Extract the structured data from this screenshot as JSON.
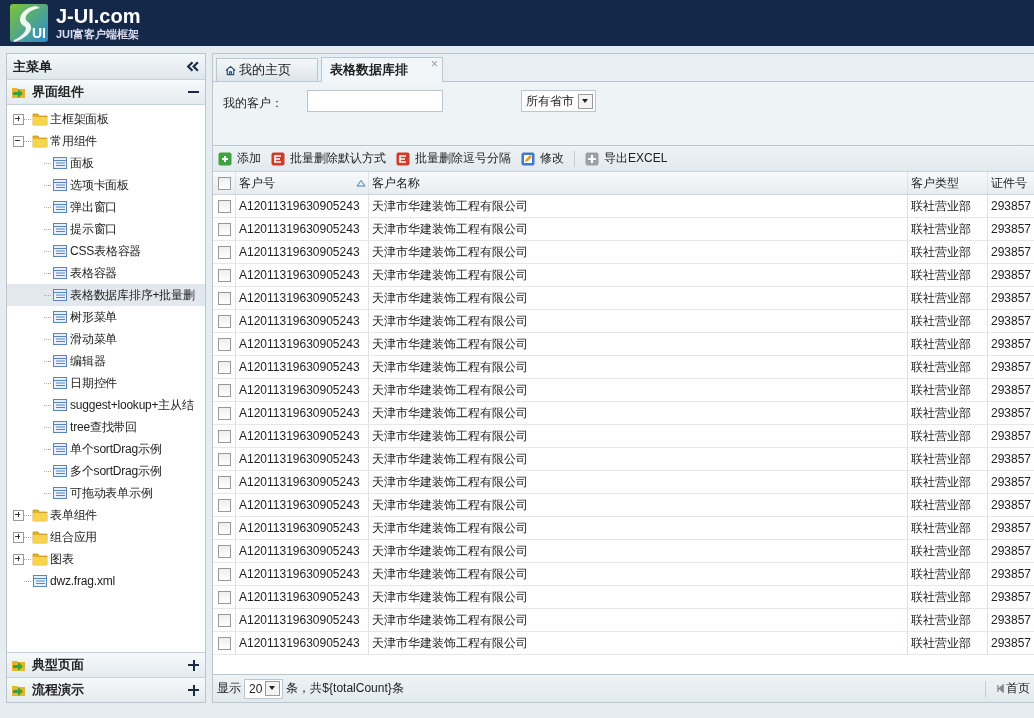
{
  "header": {
    "logo_mark": "UI",
    "site": "J-UI.com",
    "tagline": "JUI富客户端框架"
  },
  "sidebar": {
    "title": "主菜单",
    "sections": [
      {
        "label": "界面组件",
        "expanded": true,
        "tree": [
          {
            "label": "主框架面板",
            "kind": "folder",
            "expanded": false,
            "selected": false
          },
          {
            "label": "常用组件",
            "kind": "folder",
            "expanded": true,
            "selected": false,
            "children": [
              {
                "label": "面板",
                "kind": "page",
                "selected": false
              },
              {
                "label": "选项卡面板",
                "kind": "page",
                "selected": false
              },
              {
                "label": "弹出窗口",
                "kind": "page",
                "selected": false
              },
              {
                "label": "提示窗口",
                "kind": "page",
                "selected": false
              },
              {
                "label": "CSS表格容器",
                "kind": "page",
                "selected": false
              },
              {
                "label": "表格容器",
                "kind": "page",
                "selected": false
              },
              {
                "label": "表格数据库排序+批量删",
                "kind": "page",
                "selected": true
              },
              {
                "label": "树形菜单",
                "kind": "page",
                "selected": false
              },
              {
                "label": "滑动菜单",
                "kind": "page",
                "selected": false
              },
              {
                "label": "编辑器",
                "kind": "page",
                "selected": false
              },
              {
                "label": "日期控件",
                "kind": "page",
                "selected": false
              },
              {
                "label": "suggest+lookup+主从结",
                "kind": "page",
                "selected": false
              },
              {
                "label": "tree查找带回",
                "kind": "page",
                "selected": false
              },
              {
                "label": "单个sortDrag示例",
                "kind": "page",
                "selected": false
              },
              {
                "label": "多个sortDrag示例",
                "kind": "page",
                "selected": false
              },
              {
                "label": "可拖动表单示例",
                "kind": "page",
                "selected": false
              }
            ]
          },
          {
            "label": "表单组件",
            "kind": "folder",
            "expanded": false,
            "selected": false
          },
          {
            "label": "组合应用",
            "kind": "folder",
            "expanded": false,
            "selected": false
          },
          {
            "label": "图表",
            "kind": "folder",
            "expanded": false,
            "selected": false
          },
          {
            "label": "dwz.frag.xml",
            "kind": "page",
            "selected": false
          }
        ]
      },
      {
        "label": "典型页面",
        "expanded": false
      },
      {
        "label": "流程演示",
        "expanded": false
      }
    ]
  },
  "tabs": [
    {
      "label": "我的主页",
      "kind": "home",
      "selected": false
    },
    {
      "label": "表格数据库排",
      "kind": "closable",
      "selected": true,
      "close": "×"
    }
  ],
  "search": {
    "label": "我的客户：",
    "select": "所有省市"
  },
  "toolbar": [
    {
      "label": "添加",
      "kind": "add"
    },
    {
      "label": "批量删除默认方式",
      "kind": "delete"
    },
    {
      "label": "批量删除逗号分隔",
      "kind": "delete"
    },
    {
      "label": "修改",
      "kind": "edit"
    },
    {
      "label": "导出EXCEL",
      "kind": "export"
    }
  ],
  "table": {
    "columns": [
      {
        "label": "客户号",
        "sorted": true
      },
      {
        "label": "客户名称",
        "sorted": false
      },
      {
        "label": "客户类型",
        "sorted": false
      },
      {
        "label": "证件号",
        "sorted": false
      }
    ],
    "all_checked": false,
    "rows": [
      {
        "id": "A12011319630905243",
        "name": "天津市华建装饰工程有限公司",
        "type": "联社营业部",
        "cert": "293857",
        "checked": false
      },
      {
        "id": "A12011319630905243",
        "name": "天津市华建装饰工程有限公司",
        "type": "联社营业部",
        "cert": "293857",
        "checked": false
      },
      {
        "id": "A12011319630905243",
        "name": "天津市华建装饰工程有限公司",
        "type": "联社营业部",
        "cert": "293857",
        "checked": false
      },
      {
        "id": "A12011319630905243",
        "name": "天津市华建装饰工程有限公司",
        "type": "联社营业部",
        "cert": "293857",
        "checked": false
      },
      {
        "id": "A12011319630905243",
        "name": "天津市华建装饰工程有限公司",
        "type": "联社营业部",
        "cert": "293857",
        "checked": false
      },
      {
        "id": "A12011319630905243",
        "name": "天津市华建装饰工程有限公司",
        "type": "联社营业部",
        "cert": "293857",
        "checked": false
      },
      {
        "id": "A12011319630905243",
        "name": "天津市华建装饰工程有限公司",
        "type": "联社营业部",
        "cert": "293857",
        "checked": false
      },
      {
        "id": "A12011319630905243",
        "name": "天津市华建装饰工程有限公司",
        "type": "联社营业部",
        "cert": "293857",
        "checked": false
      },
      {
        "id": "A12011319630905243",
        "name": "天津市华建装饰工程有限公司",
        "type": "联社营业部",
        "cert": "293857",
        "checked": false
      },
      {
        "id": "A12011319630905243",
        "name": "天津市华建装饰工程有限公司",
        "type": "联社营业部",
        "cert": "293857",
        "checked": false
      },
      {
        "id": "A12011319630905243",
        "name": "天津市华建装饰工程有限公司",
        "type": "联社营业部",
        "cert": "293857",
        "checked": false
      },
      {
        "id": "A12011319630905243",
        "name": "天津市华建装饰工程有限公司",
        "type": "联社营业部",
        "cert": "293857",
        "checked": false
      },
      {
        "id": "A12011319630905243",
        "name": "天津市华建装饰工程有限公司",
        "type": "联社营业部",
        "cert": "293857",
        "checked": false
      },
      {
        "id": "A12011319630905243",
        "name": "天津市华建装饰工程有限公司",
        "type": "联社营业部",
        "cert": "293857",
        "checked": false
      },
      {
        "id": "A12011319630905243",
        "name": "天津市华建装饰工程有限公司",
        "type": "联社营业部",
        "cert": "293857",
        "checked": false
      },
      {
        "id": "A12011319630905243",
        "name": "天津市华建装饰工程有限公司",
        "type": "联社营业部",
        "cert": "293857",
        "checked": false
      },
      {
        "id": "A12011319630905243",
        "name": "天津市华建装饰工程有限公司",
        "type": "联社营业部",
        "cert": "293857",
        "checked": false
      },
      {
        "id": "A12011319630905243",
        "name": "天津市华建装饰工程有限公司",
        "type": "联社营业部",
        "cert": "293857",
        "checked": false
      },
      {
        "id": "A12011319630905243",
        "name": "天津市华建装饰工程有限公司",
        "type": "联社营业部",
        "cert": "293857",
        "checked": false
      },
      {
        "id": "A12011319630905243",
        "name": "天津市华建装饰工程有限公司",
        "type": "联社营业部",
        "cert": "293857",
        "checked": false
      }
    ]
  },
  "pager": {
    "show": "显示",
    "page_size": "20",
    "total": "条，共${totalCount}条",
    "first": "首页"
  }
}
